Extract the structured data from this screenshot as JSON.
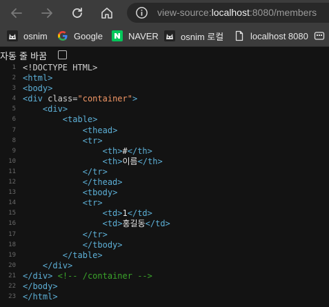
{
  "browser": {
    "url_scheme": "view-source:",
    "url_host": "localhost",
    "url_rest": ":8080/members"
  },
  "bookmarks": [
    {
      "label": "osnim",
      "icon": "cat-avatar-icon"
    },
    {
      "label": "Google",
      "icon": "google-g-icon"
    },
    {
      "label": "NAVER",
      "icon": "naver-n-icon"
    },
    {
      "label": "osnim 로컬",
      "icon": "cat-avatar-icon"
    },
    {
      "label": "localhost 8080",
      "icon": "page-icon"
    }
  ],
  "view_source": {
    "line_wrap_label": "자동 줄 바꿈",
    "line_wrap_checked": false,
    "lines": [
      {
        "n": "1",
        "text": "<!DOCTYPE HTML>"
      },
      {
        "n": "2",
        "text": "<html>"
      },
      {
        "n": "3",
        "text": "<body>"
      },
      {
        "n": "4",
        "text": "<div class=\"container\">"
      },
      {
        "n": "5",
        "text": "    <div>"
      },
      {
        "n": "6",
        "text": "        <table>"
      },
      {
        "n": "7",
        "text": "            <thead>"
      },
      {
        "n": "8",
        "text": "            <tr>"
      },
      {
        "n": "9",
        "text": "                <th>#</th>"
      },
      {
        "n": "10",
        "text": "                <th>이름</th>"
      },
      {
        "n": "11",
        "text": "            </tr>"
      },
      {
        "n": "12",
        "text": "            </thead>"
      },
      {
        "n": "13",
        "text": "            <tbody>"
      },
      {
        "n": "14",
        "text": "            <tr>"
      },
      {
        "n": "15",
        "text": "                <td>1</td>"
      },
      {
        "n": "16",
        "text": "                <td>홍길동</td>"
      },
      {
        "n": "17",
        "text": "            </tr>"
      },
      {
        "n": "18",
        "text": "            </tbody>"
      },
      {
        "n": "19",
        "text": "        </table>"
      },
      {
        "n": "20",
        "text": "    </div>"
      },
      {
        "n": "21",
        "text": "</div> <!-- /container -->"
      },
      {
        "n": "22",
        "text": "</body>"
      },
      {
        "n": "23",
        "text": "</html>"
      }
    ]
  },
  "colors": {
    "tag": "#5db0d7",
    "attr_value": "#f29766",
    "comment": "#3aa42a",
    "background": "#131313"
  }
}
